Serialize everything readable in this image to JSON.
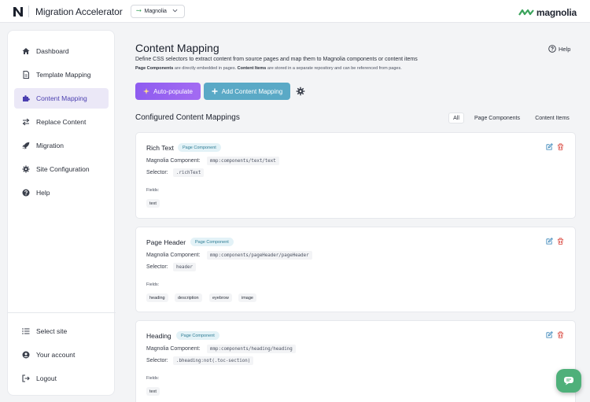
{
  "app": {
    "title": "Migration Accelerator",
    "site": "Magnolia",
    "brand": "magnolia"
  },
  "sidebar": {
    "items": [
      {
        "label": "Dashboard",
        "icon": "home-icon"
      },
      {
        "label": "Template Mapping",
        "icon": "document-icon"
      },
      {
        "label": "Content Mapping",
        "icon": "puzzle-icon",
        "active": true
      },
      {
        "label": "Replace Content",
        "icon": "swap-icon"
      },
      {
        "label": "Migration",
        "icon": "rocket-icon"
      },
      {
        "label": "Site Configuration",
        "icon": "gear-icon"
      },
      {
        "label": "Help",
        "icon": "question-icon"
      }
    ],
    "bottom": [
      {
        "label": "Select site",
        "icon": "list-icon"
      },
      {
        "label": "Your account",
        "icon": "user-icon"
      },
      {
        "label": "Logout",
        "icon": "logout-icon"
      }
    ]
  },
  "page": {
    "title": "Content Mapping",
    "help": "Help",
    "description": "Define CSS selectors to extract content from source pages and map them to Magnolia components or content items",
    "note_pc_strong": "Page Components",
    "note_pc": " are directly embedded in pages. ",
    "note_ci_strong": "Content Items",
    "note_ci": " are stored in a separate repository and can be referenced from pages."
  },
  "actions": {
    "auto_populate": "Auto-populate",
    "add_mapping": "Add Content Mapping"
  },
  "mappings": {
    "title": "Configured Content Mappings",
    "filters": [
      "All",
      "Page Components",
      "Content Items"
    ],
    "component_label": "Magnolia Component:",
    "selector_label": "Selector:",
    "fields_label": "Fields:",
    "cards": [
      {
        "name": "Rich Text",
        "badge": "Page Component",
        "component": "mmp:components/text/text",
        "selector": ".richText",
        "fields": [
          "text"
        ]
      },
      {
        "name": "Page Header",
        "badge": "Page Component",
        "component": "mmp:components/pageHeader/pageHeader",
        "selector": "header",
        "fields": [
          "heading",
          "description",
          "eyebrow",
          "image"
        ]
      },
      {
        "name": "Heading",
        "badge": "Page Component",
        "component": "mmp:components/heading/heading",
        "selector": ".bheading:not(.toc-section)",
        "fields": [
          "text"
        ]
      }
    ]
  },
  "colors": {
    "accent": "#4b3fb0",
    "auto_button": "#9a66f1",
    "add_button": "#5aa9c6",
    "badge_bg": "#e3f2f7",
    "edit": "#2f7fb5",
    "delete": "#d9443b",
    "chat": "#4fb07a"
  }
}
